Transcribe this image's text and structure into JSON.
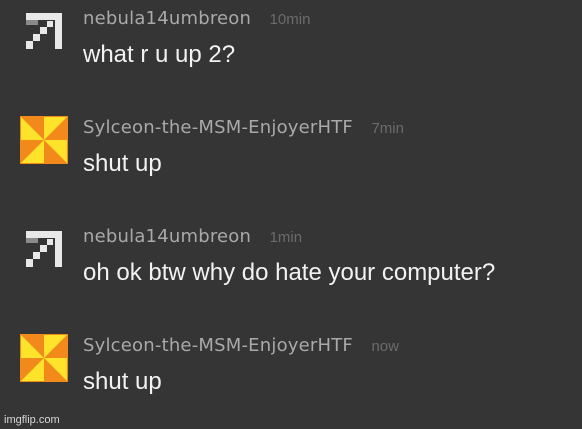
{
  "messages": [
    {
      "username": "nebula14umbreon",
      "time": "10min",
      "text": "what r u up 2?",
      "avatar": "pixel-arrow-icon"
    },
    {
      "username": "Sylceon-the-MSM-EnjoyerHTF",
      "time": "7min",
      "text": "shut up",
      "avatar": "pinwheel-icon"
    },
    {
      "username": "nebula14umbreon",
      "time": "1min",
      "text": "oh ok btw why do hate your computer?",
      "avatar": "pixel-arrow-icon"
    },
    {
      "username": "Sylceon-the-MSM-EnjoyerHTF",
      "time": "now",
      "text": "shut up",
      "avatar": "pinwheel-icon"
    }
  ],
  "watermark": "imgflip.com",
  "colors": {
    "background": "#353535",
    "username": "#a9a9a9",
    "timestamp": "#6b6b6b",
    "message_text": "#f2f2f2",
    "arrow_light": "#e8e8e8",
    "arrow_dark": "#8a8a8a",
    "pinwheel_orange": "#f28a1b",
    "pinwheel_yellow": "#ffe32a"
  }
}
